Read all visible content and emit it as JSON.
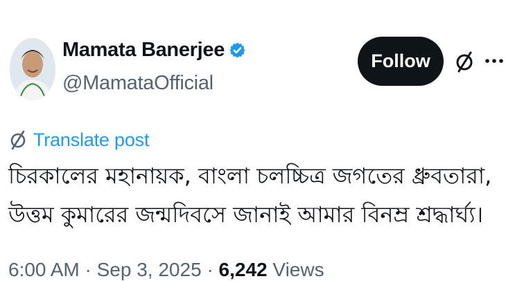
{
  "author": {
    "name": "Mamata Banerjee",
    "handle": "@MamataOfficial",
    "verified_color": "#1d9bf0"
  },
  "actions": {
    "follow_label": "Follow",
    "grok_icon": "grok-icon",
    "more_icon": "more-icon"
  },
  "post": {
    "translate_label": "Translate post",
    "text": "চিরকালের মহানায়ক, বাংলা চলচ্চিত্র জগতের ধ্রুবতারা, উত্তম কুমারের জন্মদিবসে জানাই আমার বিনম্র শ্রদ্ধার্ঘ্য।"
  },
  "meta": {
    "time": "6:00 AM",
    "separator": "·",
    "date": "Sep 3, 2025",
    "views_count": "6,242",
    "views_label": "Views"
  },
  "colors": {
    "link": "#1d9bf0",
    "secondary_text": "#536471",
    "primary_text": "#0f1419",
    "button_bg": "#0f1419"
  }
}
